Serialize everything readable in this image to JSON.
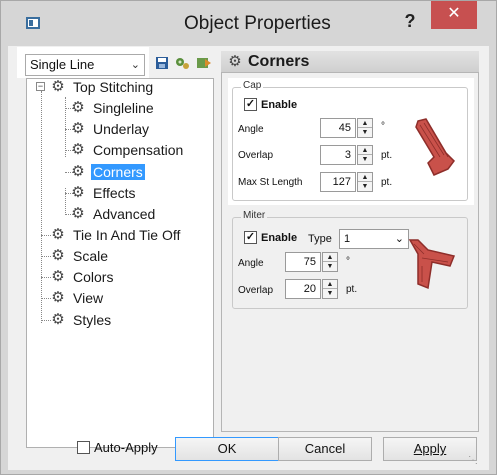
{
  "window": {
    "title": "Object Properties",
    "help_label": "?",
    "close_label": "✕"
  },
  "left_panel": {
    "mode_combo_value": "Single Line",
    "toolbar_icons": [
      "save-icon",
      "gear-settings-icon",
      "export-icon"
    ],
    "tree": {
      "expander": "−",
      "root": "Top Stitching",
      "children": [
        "Singleline",
        "Underlay",
        "Compensation",
        "Corners",
        "Effects",
        "Advanced"
      ],
      "selected": "Corners",
      "siblings": [
        "Tie In And Tie Off",
        "Scale",
        "Colors",
        "View",
        "Styles"
      ]
    }
  },
  "right_panel": {
    "header_title": "Corners",
    "cap": {
      "legend": "Cap",
      "enable_label": "Enable",
      "enable_checked": "✓",
      "angle_label": "Angle",
      "angle_value": "45",
      "angle_unit": "°",
      "overlap_label": "Overlap",
      "overlap_value": "3",
      "overlap_unit": "pt.",
      "max_label": "Max St Length",
      "max_value": "127",
      "max_unit": "pt."
    },
    "miter": {
      "legend": "Miter",
      "enable_label": "Enable",
      "enable_checked": "✓",
      "type_label": "Type",
      "type_value": "1",
      "angle_label": "Angle",
      "angle_value": "75",
      "angle_unit": "°",
      "overlap_label": "Overlap",
      "overlap_value": "20",
      "overlap_unit": "pt."
    },
    "preview_colors": {
      "fill": "#c9514a",
      "edge": "#8e2e2a"
    }
  },
  "footer": {
    "auto_apply_label": "Auto-Apply",
    "ok_label": "OK",
    "cancel_label": "Cancel",
    "apply_label": "Apply"
  }
}
